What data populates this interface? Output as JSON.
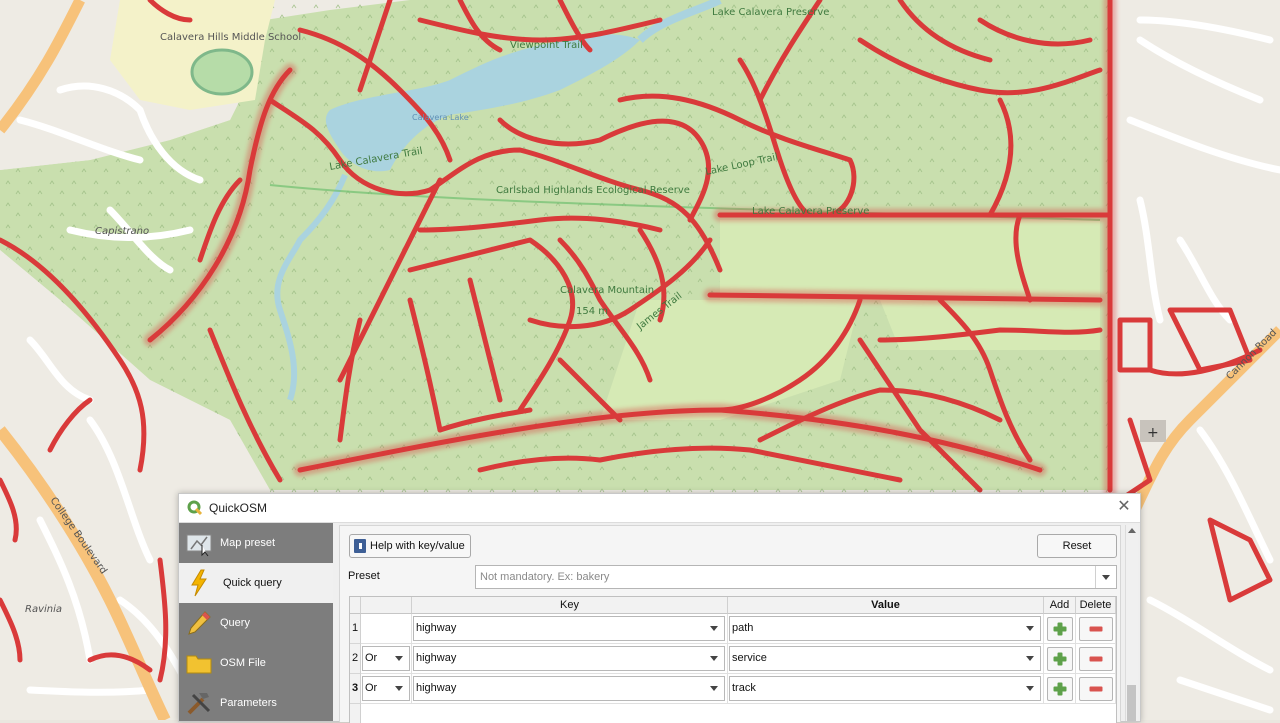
{
  "map": {
    "labels": {
      "lake_calavera_preserve": "Lake Calavera Preserve",
      "calavera_hills_middle_school": "Calavera Hills Middle School",
      "calavera_lake": "Calavera Lake",
      "calavera_mountain": "Calavera Mountain",
      "mountain_elevation": "154 m",
      "viewpoint_trail": "Viewpoint Trail",
      "carlsbad_highlands": "Carlsbad Highlands Ecological Reserve",
      "lake_loop_trail": "Lake Loop Trail",
      "lake_calavera_preserve_2": "Lake Calavera Preserve",
      "james_trail": "James Trail",
      "capistrano": "Capistrano",
      "cannon_road": "Cannon Road",
      "college_boulevard": "College Boulevard",
      "ravinia": "Ravinia",
      "lake_calavera_trail": "Lake Calavera Trail"
    },
    "colors": {
      "park": "#c9dfae",
      "meadow": "#d6eab5",
      "water": "#aad3df",
      "road": "#f7c27a",
      "path": "#d93a3a"
    }
  },
  "dialog": {
    "title": "QuickOSM",
    "close_glyph": "✕",
    "sidebar": [
      {
        "label": "Map preset",
        "icon": "map-preset-icon"
      },
      {
        "label": "Quick query",
        "icon": "lightning-icon"
      },
      {
        "label": "Query",
        "icon": "pencil-icon"
      },
      {
        "label": "OSM File",
        "icon": "folder-icon"
      },
      {
        "label": "Parameters",
        "icon": "tools-icon"
      }
    ],
    "help_button": "Help with key/value",
    "reset_button": "Reset",
    "preset": {
      "label": "Preset",
      "placeholder": "Not mandatory. Ex: bakery"
    },
    "table": {
      "headers": {
        "key": "Key",
        "value": "Value",
        "add": "Add",
        "delete": "Delete"
      },
      "rows": [
        {
          "num": "1",
          "op": "",
          "key": "highway",
          "value": "path"
        },
        {
          "num": "2",
          "op": "Or",
          "key": "highway",
          "value": "service"
        },
        {
          "num": "3",
          "op": "Or",
          "key": "highway",
          "value": "track"
        }
      ]
    }
  }
}
